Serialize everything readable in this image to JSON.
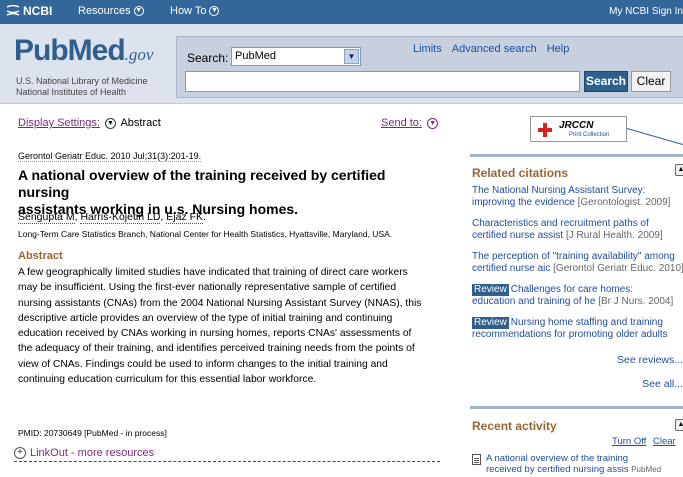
{
  "topbar": {
    "logo": "NCBI",
    "resources": "Resources",
    "howto": "How To",
    "right": "My NCBI  Sign In"
  },
  "header": {
    "logo_pub": "Pub",
    "logo_med": "Med",
    "logo_gov": ".gov",
    "sub1": "U.S. National Library of Medicine",
    "sub2": "National Institutes of Health",
    "search_label": "Search:",
    "db_value": "PubMed",
    "links": [
      "Limits",
      "Advanced search",
      "Help"
    ],
    "query_value": "",
    "search_button": "Search",
    "clear_button": "Clear"
  },
  "main": {
    "display_settings": "Display Settings:",
    "display_value": "Abstract",
    "send_to": "Send to:",
    "citation": "Gerontol Geriatr Educ. 2010 Jul;31(3):201-19.",
    "title_line1": "A national overview of the training received by certified nursing",
    "title_line2": "assistants working in u.s. Nursing homes.",
    "authors": [
      "Sengupta M",
      "Harris-Kojetin LD",
      "Ejaz FK"
    ],
    "affiliation": "Long-Term Care Statistics Branch, National Center for Health Statistics, Hyattsville, Maryland, USA.",
    "abstract_heading": "Abstract",
    "abstract_lines": [
      "A few geographically limited studies have indicated that training of direct care workers",
      "may be insufficient. Using the first-ever nationally representative sample of certified",
      "nursing assistants (CNAs) from the 2004 National Nursing Assistant Survey (NNAS), this",
      "descriptive article provides an overview of the type of initial training and continuing",
      "education received by CNAs working in nursing homes, reports CNAs' assessments of",
      "the adequacy of their training, and identifies perceived training needs from the points of",
      "view of CNAs. Findings could be used to inform changes to the initial training and",
      "continuing education curriculum for this essential labor workforce."
    ],
    "pmid": "PMID: 20730649 [PubMed - in process]",
    "linkout": "LinkOut - more resources"
  },
  "sidebar": {
    "jrccn_name": "JRCCN",
    "jrccn_sub": "Print Collection",
    "related_heading": "Related citations",
    "related": [
      {
        "line1": "The National Nursing Assistant Survey:",
        "line2": "improving the evidence",
        "source": "[Gerontologist. 2009]",
        "review": ""
      },
      {
        "line1": "Characteristics and recruitment paths of",
        "line2": "certified nurse assist",
        "source": "[J Rural Health. 2009]",
        "review": ""
      },
      {
        "line1": "The perception of \"training availability\" among",
        "line2": "certified nurse aic",
        "source": "[Gerontol Geriatr Educ. 2010]",
        "review": ""
      },
      {
        "line1": "Challenges for care homes:",
        "line2": "education and training of he",
        "source": "[Br J Nurs. 2004]",
        "review": "Review"
      },
      {
        "line1": "Nursing home staffing and training",
        "line2": "recommendations for promoting older adults",
        "source": "",
        "review": "Review"
      }
    ],
    "see_reviews": "See reviews...",
    "see_all": "See all...",
    "recent_heading": "Recent activity",
    "turn_off": "Turn Off",
    "clear": "Clear",
    "recent_line1": "A national overview of the training",
    "recent_line2": "received by certified nursing assis",
    "recent_source": "PubMed"
  }
}
